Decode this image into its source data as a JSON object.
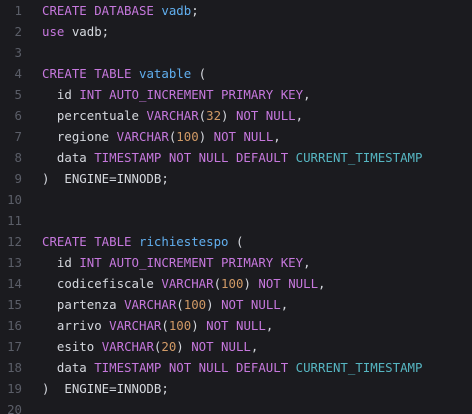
{
  "lines": [
    {
      "n": "1",
      "t": [
        {
          "c": "kw",
          "v": "CREATE DATABASE "
        },
        {
          "c": "id",
          "v": "vadb"
        },
        {
          "c": "pl",
          "v": ";"
        }
      ]
    },
    {
      "n": "2",
      "t": [
        {
          "c": "kw",
          "v": "use "
        },
        {
          "c": "pl",
          "v": "vadb;"
        }
      ]
    },
    {
      "n": "3",
      "t": []
    },
    {
      "n": "4",
      "t": [
        {
          "c": "kw",
          "v": "CREATE TABLE "
        },
        {
          "c": "id",
          "v": "vatable"
        },
        {
          "c": "pl",
          "v": " ("
        }
      ]
    },
    {
      "n": "5",
      "t": [
        {
          "c": "pl",
          "v": "  id "
        },
        {
          "c": "kw",
          "v": "INT AUTO_INCREMENT PRIMARY KEY"
        },
        {
          "c": "pl",
          "v": ","
        }
      ]
    },
    {
      "n": "6",
      "t": [
        {
          "c": "pl",
          "v": "  percentuale "
        },
        {
          "c": "kw",
          "v": "VARCHAR"
        },
        {
          "c": "pl",
          "v": "("
        },
        {
          "c": "num",
          "v": "32"
        },
        {
          "c": "pl",
          "v": ") "
        },
        {
          "c": "kw",
          "v": "NOT NULL"
        },
        {
          "c": "pl",
          "v": ","
        }
      ]
    },
    {
      "n": "7",
      "t": [
        {
          "c": "pl",
          "v": "  regione "
        },
        {
          "c": "kw",
          "v": "VARCHAR"
        },
        {
          "c": "pl",
          "v": "("
        },
        {
          "c": "num",
          "v": "100"
        },
        {
          "c": "pl",
          "v": ") "
        },
        {
          "c": "kw",
          "v": "NOT NULL"
        },
        {
          "c": "pl",
          "v": ","
        }
      ]
    },
    {
      "n": "8",
      "t": [
        {
          "c": "pl",
          "v": "  data "
        },
        {
          "c": "kw",
          "v": "TIMESTAMP NOT NULL DEFAULT "
        },
        {
          "c": "fn",
          "v": "CURRENT_TIMESTAMP"
        }
      ]
    },
    {
      "n": "9",
      "t": [
        {
          "c": "pl",
          "v": ")  ENGINE=INNODB;"
        }
      ]
    },
    {
      "n": "10",
      "t": []
    },
    {
      "n": "11",
      "t": []
    },
    {
      "n": "12",
      "t": [
        {
          "c": "kw",
          "v": "CREATE TABLE "
        },
        {
          "c": "id",
          "v": "richiestespo"
        },
        {
          "c": "pl",
          "v": " ("
        }
      ]
    },
    {
      "n": "13",
      "t": [
        {
          "c": "pl",
          "v": "  id "
        },
        {
          "c": "kw",
          "v": "INT AUTO_INCREMENT PRIMARY KEY"
        },
        {
          "c": "pl",
          "v": ","
        }
      ]
    },
    {
      "n": "14",
      "t": [
        {
          "c": "pl",
          "v": "  codicefiscale "
        },
        {
          "c": "kw",
          "v": "VARCHAR"
        },
        {
          "c": "pl",
          "v": "("
        },
        {
          "c": "num",
          "v": "100"
        },
        {
          "c": "pl",
          "v": ") "
        },
        {
          "c": "kw",
          "v": "NOT NULL"
        },
        {
          "c": "pl",
          "v": ","
        }
      ]
    },
    {
      "n": "15",
      "t": [
        {
          "c": "pl",
          "v": "  partenza "
        },
        {
          "c": "kw",
          "v": "VARCHAR"
        },
        {
          "c": "pl",
          "v": "("
        },
        {
          "c": "num",
          "v": "100"
        },
        {
          "c": "pl",
          "v": ") "
        },
        {
          "c": "kw",
          "v": "NOT NULL"
        },
        {
          "c": "pl",
          "v": ","
        }
      ]
    },
    {
      "n": "16",
      "t": [
        {
          "c": "pl",
          "v": "  arrivo "
        },
        {
          "c": "kw",
          "v": "VARCHAR"
        },
        {
          "c": "pl",
          "v": "("
        },
        {
          "c": "num",
          "v": "100"
        },
        {
          "c": "pl",
          "v": ") "
        },
        {
          "c": "kw",
          "v": "NOT NULL"
        },
        {
          "c": "pl",
          "v": ","
        }
      ]
    },
    {
      "n": "17",
      "t": [
        {
          "c": "pl",
          "v": "  esito "
        },
        {
          "c": "kw",
          "v": "VARCHAR"
        },
        {
          "c": "pl",
          "v": "("
        },
        {
          "c": "num",
          "v": "20"
        },
        {
          "c": "pl",
          "v": ") "
        },
        {
          "c": "kw",
          "v": "NOT NULL"
        },
        {
          "c": "pl",
          "v": ","
        }
      ]
    },
    {
      "n": "18",
      "t": [
        {
          "c": "pl",
          "v": "  data "
        },
        {
          "c": "kw",
          "v": "TIMESTAMP NOT NULL DEFAULT "
        },
        {
          "c": "fn",
          "v": "CURRENT_TIMESTAMP"
        }
      ]
    },
    {
      "n": "19",
      "t": [
        {
          "c": "pl",
          "v": ")  ENGINE=INNODB;"
        }
      ]
    },
    {
      "n": "20",
      "t": []
    }
  ],
  "colors": {
    "background": "#1b1b1f",
    "line_number": "#5b5e68",
    "keyword": "#c678dd",
    "identifier": "#61afef",
    "function": "#56b6c2",
    "number": "#d19a66",
    "plain": "#d5d8de"
  }
}
